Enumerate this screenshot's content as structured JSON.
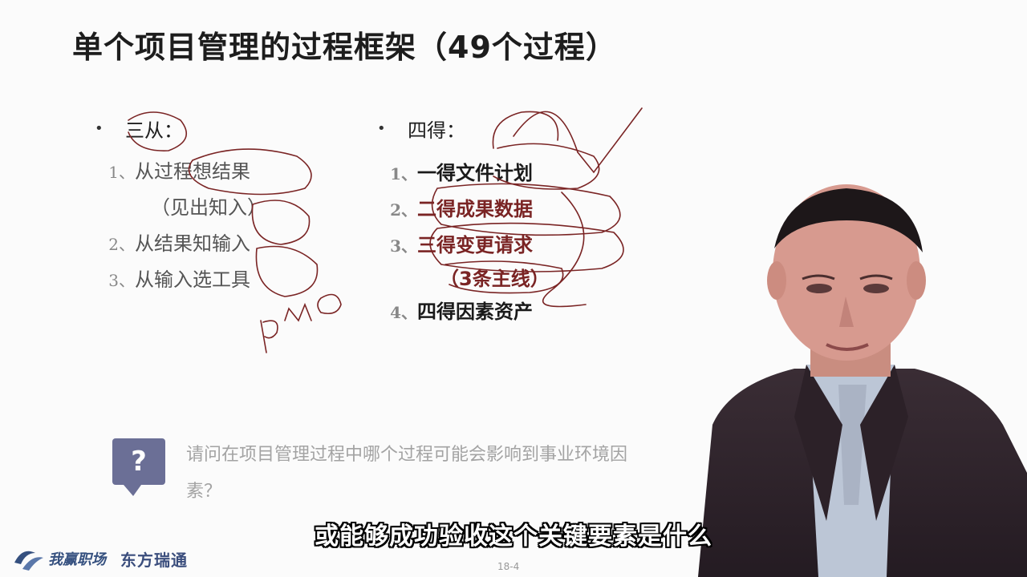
{
  "slide": {
    "title": "单个项目管理的过程框架（49个过程）",
    "page_number": "18-4"
  },
  "left_column": {
    "heading": "三从：",
    "items": [
      {
        "num": "1、",
        "text": "从过程想结果"
      },
      {
        "num": "",
        "text": "（见出知入）"
      },
      {
        "num": "2、",
        "text": "从结果知输入"
      },
      {
        "num": "3、",
        "text": "从输入选工具"
      }
    ]
  },
  "right_column": {
    "heading": "四得：",
    "items": [
      {
        "num": "1、",
        "text": "一得文件计划"
      },
      {
        "num": "2、",
        "text": "二得成果数据"
      },
      {
        "num": "3、",
        "text": "三得变更请求"
      },
      {
        "num": "",
        "text": "（3条主线）"
      },
      {
        "num": "4、",
        "text": "四得因素资产"
      }
    ]
  },
  "question": {
    "icon": "question-icon",
    "mark": "?",
    "text": "请问在项目管理过程中哪个过程可能会影响到事业环境因素？"
  },
  "handwriting": "PMO",
  "subtitle": "或能够成功验收这个关键要素是什么",
  "logos": {
    "brand_1": "我赢职场",
    "brand_2": "东方瑞通"
  },
  "colors": {
    "annotation_pen": "#7a2424",
    "question_icon": "#6b6f96",
    "logo": "#35507f"
  }
}
